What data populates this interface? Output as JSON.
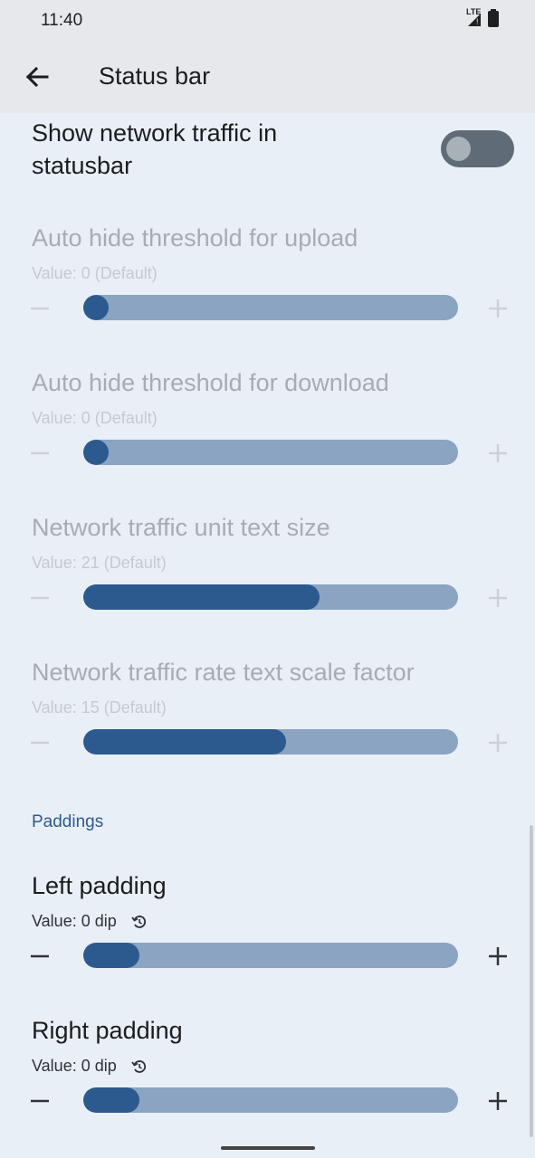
{
  "status_bar": {
    "time": "11:40",
    "network_label": "LTE"
  },
  "app_bar": {
    "title": "Status bar"
  },
  "toggle_pref": {
    "title_line1": "Show network traffic in",
    "title_line2": "statusbar",
    "checked": false
  },
  "sliders": [
    {
      "title": "Auto hide threshold for upload",
      "value_text": "Value: 0 (Default)",
      "fraction": 0.0,
      "enabled": false
    },
    {
      "title": "Auto hide threshold for download",
      "value_text": "Value: 0 (Default)",
      "fraction": 0.0,
      "enabled": false
    },
    {
      "title": "Network traffic unit text size",
      "value_text": "Value: 21 (Default)",
      "fraction": 0.63,
      "enabled": false
    },
    {
      "title": "Network traffic rate text scale factor",
      "value_text": "Value: 15 (Default)",
      "fraction": 0.54,
      "enabled": false
    }
  ],
  "section_header": "Paddings",
  "padding_sliders": [
    {
      "title": "Left padding",
      "value_text": "Value: 0 dip",
      "fraction": 0.0,
      "enabled": true
    },
    {
      "title": "Right padding",
      "value_text": "Value: 0 dip",
      "fraction": 0.0,
      "enabled": true
    }
  ],
  "icons": {
    "back": "arrow-back-icon",
    "minus": "minus-icon",
    "plus": "plus-icon",
    "reset": "reset-icon",
    "battery": "battery-icon",
    "signal": "signal-icon"
  },
  "colors": {
    "accent": "#2d5a8e",
    "track": "#8aa4c2",
    "background": "#e9eff7"
  }
}
